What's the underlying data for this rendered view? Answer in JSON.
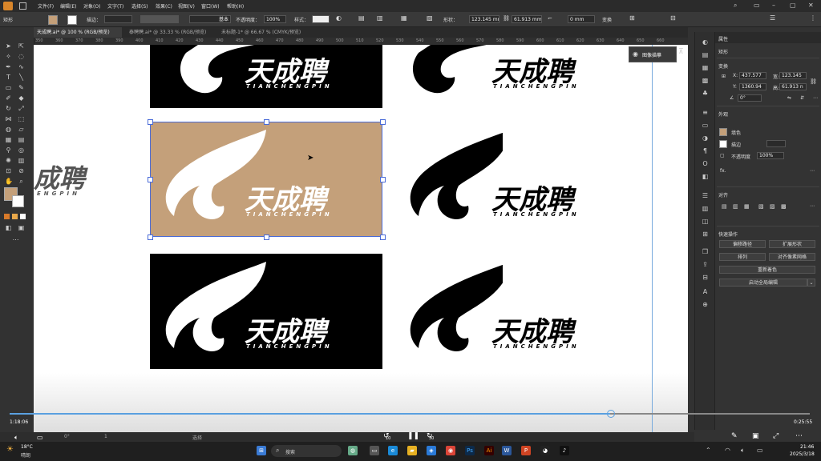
{
  "menubar": {
    "items": [
      "文件(F)",
      "编辑(E)",
      "对象(O)",
      "文字(T)",
      "选择(S)",
      "效果(C)",
      "视图(V)",
      "窗口(W)",
      "帮助(H)"
    ]
  },
  "controlbar": {
    "object_type": "矩形",
    "stroke_label": "描边：",
    "brush_label": "基本",
    "opacity_label": "不透明度：",
    "opacity_value": "100%",
    "style_label": "样式：",
    "shape_label": "形状：",
    "width_value": "123.145 mm",
    "height_value": "61.913 mm",
    "corner_value": "0 mm",
    "transform_label": "变换"
  },
  "tabs": [
    {
      "label": "天成聘.ai* @ 100 % (RGB/预览)",
      "active": true
    },
    {
      "label": "泰聘聘.ai* @ 33.33 % (RGB/预览)",
      "active": false
    },
    {
      "label": "未标题-1* @ 66.67 % (CMYK/预览)",
      "active": false
    }
  ],
  "ruler": {
    "ticks": [
      "350",
      "360",
      "370",
      "380",
      "390",
      "400",
      "410",
      "420",
      "430",
      "440",
      "450",
      "460",
      "470",
      "480",
      "490",
      "500",
      "510",
      "520",
      "530",
      "540",
      "550",
      "560",
      "570",
      "580",
      "590",
      "600",
      "610",
      "620",
      "630",
      "640",
      "650",
      "660"
    ]
  },
  "logo": {
    "name": "天成聘",
    "pinyin": "TIANCHENGPIN",
    "partial_name": "成聘",
    "partial_pinyin": "ENGPIN"
  },
  "canvas_tip": {
    "label": "图像描摹"
  },
  "colors": {
    "brand_tan": "#c4a07a",
    "black": "#000000",
    "white": "#ffffff",
    "selection": "#4a6bd8",
    "guide": "#77aadd"
  },
  "properties": {
    "tab_label": "属性",
    "object_type": "矩形",
    "transform_label": "变换",
    "x_label": "X:",
    "x_value": "437.577",
    "y_label": "Y:",
    "y_value": "1360.94",
    "w_label": "宽:",
    "w_value": "123.145",
    "h_label": "高:",
    "h_value": "61.913 n",
    "angle_value": "0°",
    "appearance_label": "外观",
    "fill_label": "填色",
    "stroke_label": "描边",
    "opacity_label": "不透明度",
    "opacity_value": "100%",
    "fx_label": "fx.",
    "align_label": "对齐",
    "quick_actions_label": "快速操作",
    "buttons": {
      "offset_path": "偏移路径",
      "expand_shape": "扩展形状",
      "arrange": "排列",
      "align_pixel": "对齐像素网格",
      "recolor": "重新着色",
      "global_edit": "启动全局编辑"
    }
  },
  "video": {
    "elapsed": "1:18:06",
    "remaining": "0:25:55",
    "progress": 0.75,
    "skip_back": "10",
    "skip_forward": "30"
  },
  "status": {
    "zoom": "100%",
    "angle": "0°",
    "page": "1",
    "mode": "选择"
  },
  "taskbar": {
    "weather_temp": "18°C",
    "weather_text": "晴朗",
    "search_placeholder": "搜索",
    "time": "21:46",
    "date": "2025/3/18"
  }
}
